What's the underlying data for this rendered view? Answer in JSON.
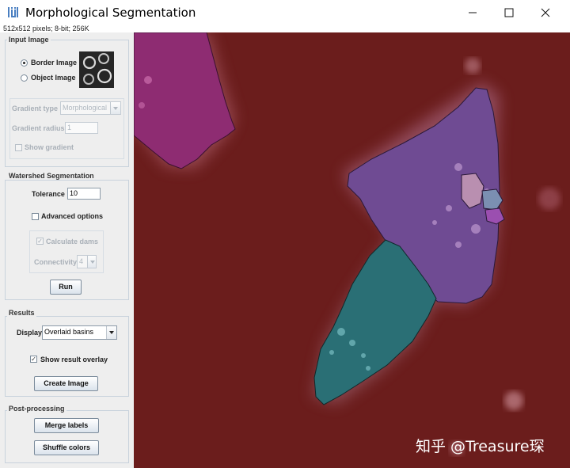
{
  "window": {
    "title": "Morphological Segmentation",
    "info": "512x512 pixels; 8-bit; 256K"
  },
  "input_image": {
    "group_label": "Input Image",
    "border_image_label": "Border Image",
    "object_image_label": "Object Image",
    "selected": "Border Image",
    "gradient_type_label": "Gradient type",
    "gradient_type_value": "Morphological",
    "gradient_radius_label": "Gradient radius",
    "gradient_radius_value": "1",
    "show_gradient_label": "Show gradient"
  },
  "watershed": {
    "group_label": "Watershed Segmentation",
    "tolerance_label": "Tolerance",
    "tolerance_value": "10",
    "advanced_options_label": "Advanced options",
    "calculate_dams_label": "Calculate dams",
    "connectivity_label": "Connectivity",
    "connectivity_value": "4",
    "run_label": "Run"
  },
  "results": {
    "group_label": "Results",
    "display_label": "Display",
    "display_value": "Overlaid basins",
    "show_overlay_label": "Show result overlay",
    "create_image_label": "Create Image"
  },
  "post_processing": {
    "group_label": "Post-processing",
    "merge_labels_label": "Merge labels",
    "shuffle_colors_label": "Shuffle colors"
  },
  "watermark": "知乎 @Treasure琛",
  "colors": {
    "background_basin": "#6b1d1c",
    "magenta_basin": "#8e2c72",
    "purple_basin": "#6f4b93",
    "teal_basin": "#2a6f75",
    "pink_basin": "#b98fb0",
    "blue_basin": "#7b8fb2",
    "violet_basin": "#9b4fb0"
  }
}
